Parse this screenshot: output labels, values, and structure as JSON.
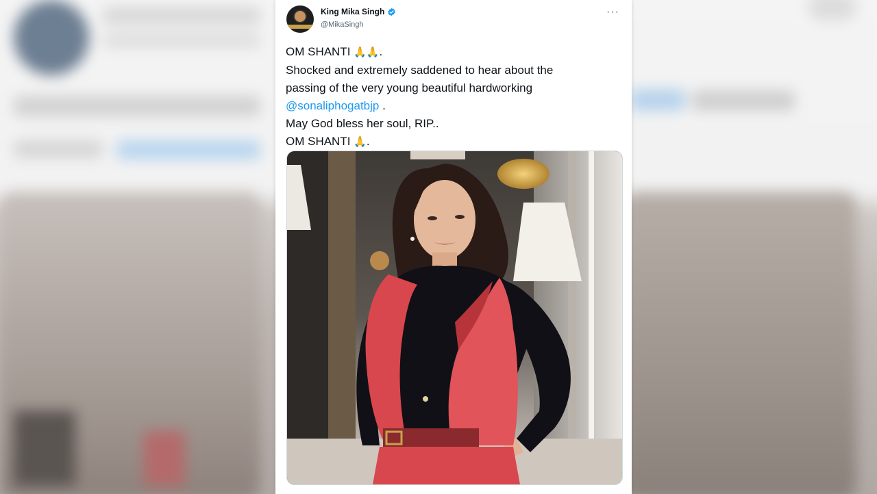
{
  "tweet": {
    "display_name": "King Mika Singh",
    "handle": "@MikaSingh",
    "verified_icon": "verified-badge-icon",
    "more_icon": "more-options-icon",
    "more_symbol": "···",
    "lines": {
      "l1": "OM SHANTI ",
      "l1_emoji": "🙏🙏",
      "l1_end": ".",
      "l2": "Shocked and extremely saddened to hear about the",
      "l3": "passing of the very young beautiful hardworking",
      "l4_mention": "@sonaliphogatbjp",
      "l4_end": " .",
      "l5": "May God bless her soul, RIP..",
      "l6": "OM SHANTI ",
      "l6_emoji": "🙏",
      "l6_end": "."
    },
    "colors": {
      "link": "#1d9bf0",
      "text": "#0f1419",
      "secondary": "#536471",
      "verified": "#1d9bf0"
    }
  }
}
